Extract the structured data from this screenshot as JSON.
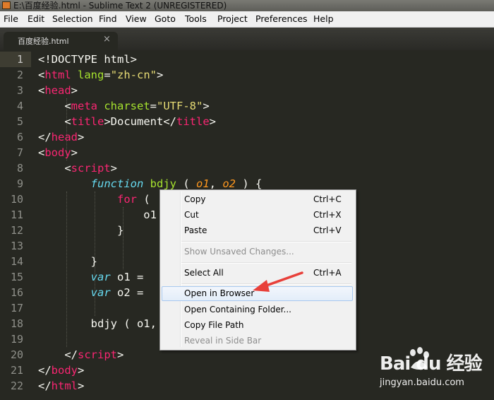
{
  "window": {
    "title": "E:\\百度经验.html - Sublime Text 2 (UNREGISTERED)"
  },
  "menubar": [
    "File",
    "Edit",
    "Selection",
    "Find",
    "View",
    "Goto",
    "Tools",
    "Project",
    "Preferences",
    "Help"
  ],
  "tab": {
    "label": "百度经验.html",
    "close": "×"
  },
  "editor": {
    "active_line": 1,
    "line_numbers": [
      "1",
      "2",
      "3",
      "4",
      "5",
      "6",
      "7",
      "8",
      "9",
      "10",
      "11",
      "12",
      "13",
      "14",
      "15",
      "16",
      "17",
      "18",
      "19",
      "20",
      "21",
      "22"
    ],
    "lines": [
      [
        [
          "",
          "<!DOCTYPE html>"
        ]
      ],
      [
        [
          "",
          "<"
        ],
        [
          "tag",
          "html"
        ],
        [
          "",
          " "
        ],
        [
          "attr",
          "lang"
        ],
        [
          "",
          "="
        ],
        [
          "str",
          "\"zh-cn\""
        ],
        [
          "",
          ">"
        ]
      ],
      [
        [
          "",
          "<"
        ],
        [
          "tag",
          "head"
        ],
        [
          "",
          ">"
        ]
      ],
      [
        [
          "",
          "    <"
        ],
        [
          "tag",
          "meta"
        ],
        [
          "",
          " "
        ],
        [
          "attr",
          "charset"
        ],
        [
          "",
          "="
        ],
        [
          "str",
          "\"UTF-8\""
        ],
        [
          "",
          ">"
        ]
      ],
      [
        [
          "",
          "    <"
        ],
        [
          "tag",
          "title"
        ],
        [
          "",
          ">Document</"
        ],
        [
          "tag",
          "title"
        ],
        [
          "",
          ">"
        ]
      ],
      [
        [
          "",
          "</"
        ],
        [
          "tag",
          "head"
        ],
        [
          "",
          ">"
        ]
      ],
      [
        [
          "",
          "<"
        ],
        [
          "tag",
          "body"
        ],
        [
          "",
          ">"
        ]
      ],
      [
        [
          "",
          "    <"
        ],
        [
          "tag",
          "script"
        ],
        [
          "",
          ">"
        ]
      ],
      [
        [
          "",
          "        "
        ],
        [
          "kw",
          "function"
        ],
        [
          "",
          " "
        ],
        [
          "fn",
          "bdjy"
        ],
        [
          "",
          " ( "
        ],
        [
          "param",
          "o1"
        ],
        [
          "",
          ", "
        ],
        [
          "param",
          "o2"
        ],
        [
          "",
          " ) {"
        ]
      ],
      [
        [
          "",
          "            "
        ],
        [
          "ctl",
          "for"
        ],
        [
          "",
          " ("
        ]
      ],
      [
        [
          "",
          "                o1"
        ]
      ],
      [
        [
          "",
          "            }"
        ]
      ],
      [
        [
          "",
          ""
        ]
      ],
      [
        [
          "",
          "        }"
        ]
      ],
      [
        [
          "",
          "        "
        ],
        [
          "kw",
          "var"
        ],
        [
          "",
          " o1 = "
        ]
      ],
      [
        [
          "",
          "        "
        ],
        [
          "kw",
          "var"
        ],
        [
          "",
          " o2 = "
        ]
      ],
      [
        [
          "",
          ""
        ]
      ],
      [
        [
          "",
          "        bdjy ( o1,"
        ]
      ],
      [
        [
          "",
          ""
        ]
      ],
      [
        [
          "",
          "    </"
        ],
        [
          "tag",
          "script"
        ],
        [
          "",
          ">"
        ]
      ],
      [
        [
          "",
          "</"
        ],
        [
          "tag",
          "body"
        ],
        [
          "",
          ">"
        ]
      ],
      [
        [
          "",
          "</"
        ],
        [
          "tag",
          "html"
        ],
        [
          "",
          ">"
        ]
      ]
    ]
  },
  "context_menu": {
    "items": [
      {
        "label": "Copy",
        "shortcut": "Ctrl+C",
        "disabled": false
      },
      {
        "label": "Cut",
        "shortcut": "Ctrl+X",
        "disabled": false
      },
      {
        "label": "Paste",
        "shortcut": "Ctrl+V",
        "disabled": false
      },
      {
        "label": "Show Unsaved Changes...",
        "shortcut": "",
        "disabled": true
      },
      {
        "label": "Select All",
        "shortcut": "Ctrl+A",
        "disabled": false
      },
      {
        "label": "Open in Browser",
        "shortcut": "",
        "disabled": false,
        "highlighted": true
      },
      {
        "label": "Open Containing Folder...",
        "shortcut": "",
        "disabled": false
      },
      {
        "label": "Copy File Path",
        "shortcut": "",
        "disabled": false
      },
      {
        "label": "Reveal in Side Bar",
        "shortcut": "",
        "disabled": true
      }
    ]
  },
  "watermark": {
    "logo": "Bai du 经验",
    "url": "jingyan.baidu.com"
  },
  "colors": {
    "editor_bg": "#272822",
    "tag": "#f92672",
    "attr": "#a6e22e",
    "string": "#e6db74",
    "keyword": "#66d9ef",
    "param": "#fd971f",
    "arrow": "#e8403a"
  }
}
